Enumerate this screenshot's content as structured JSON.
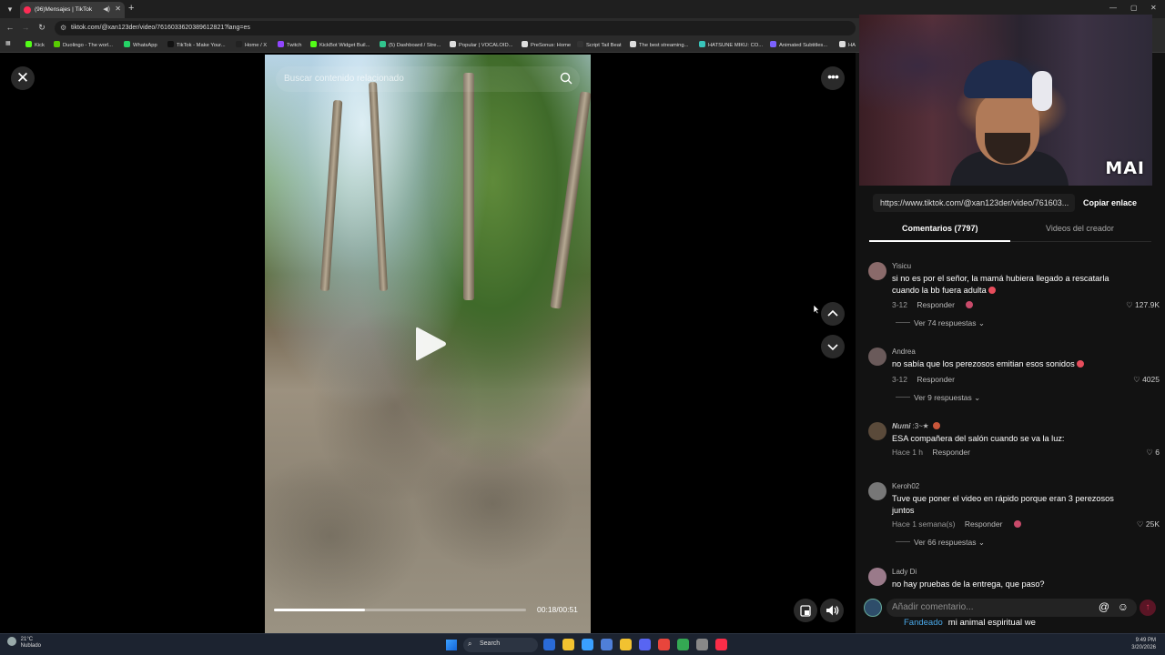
{
  "browser": {
    "tab_title": "(96)Mensajes | TikTok",
    "url": "tiktok.com/@xan123der/video/7616033620389612821?lang=es",
    "bookmarks": [
      {
        "label": "Kick",
        "color": "#53fc18"
      },
      {
        "label": "Duolingo - The worl...",
        "color": "#58cc02"
      },
      {
        "label": "WhatsApp",
        "color": "#25d366"
      },
      {
        "label": "TikTok - Make Your...",
        "color": "#111111"
      },
      {
        "label": "Home / X",
        "color": "#222222"
      },
      {
        "label": "Twitch",
        "color": "#9146ff"
      },
      {
        "label": "KickBot Widget Buil...",
        "color": "#53fc18"
      },
      {
        "label": "(5) Dashboard / Stre...",
        "color": "#31c48d"
      },
      {
        "label": "Popular | VOCALOID...",
        "color": "#dddddd"
      },
      {
        "label": "PreSonus: Home",
        "color": "#dddddd"
      },
      {
        "label": "Script Tail Beat",
        "color": "#333333"
      },
      {
        "label": "The best streaming...",
        "color": "#dddddd"
      },
      {
        "label": "HATSUNE MIKU: CO...",
        "color": "#39c5bb"
      },
      {
        "label": "Animated Subtitles...",
        "color": "#7b61ff"
      },
      {
        "label": "HA",
        "color": "#dddddd"
      }
    ]
  },
  "video": {
    "search_placeholder": "Buscar contenido relacionado",
    "time": "00:18/00:51",
    "progress_fraction": 0.36
  },
  "overlay": {
    "streamer_tag": "MAI"
  },
  "share": {
    "url": "https://www.tiktok.com/@xan123der/video/761603...",
    "copy_label": "Copiar enlace"
  },
  "panel_tabs": [
    {
      "label": "Comentarios (7797)"
    },
    {
      "label": "Videos del creador"
    }
  ],
  "comments": [
    {
      "user": "Yisicu",
      "text": "si no es por el señor, la mamá hubiera llegado a rescatarla cuando la bb fuera adulta",
      "date": "3-12",
      "reply": "Responder",
      "likes": "127.9K",
      "more": "Ver 74 respuestas",
      "avatar_color": "#8a6a6a"
    },
    {
      "user": "Andrea",
      "text": "no sabía que los perezosos emitian esos sonidos",
      "date": "3-12",
      "reply": "Responder",
      "likes": "4025",
      "more": "Ver 9 respuestas",
      "avatar_color": "#6a5a5a"
    },
    {
      "user": "𝑵𝒖𝒎𝒊 :3~★",
      "text": "ESA compañera del salón cuando se va la luz:",
      "date": "Hace 1 h",
      "reply": "Responder",
      "likes": "6",
      "more": "",
      "avatar_color": "#5a4a3a"
    },
    {
      "user": "Keroh02",
      "text": "Tuve que poner el video en rápido porque eran 3 perezosos juntos",
      "date": "Hace 1 semana(s)",
      "reply": "Responder",
      "likes": "25K",
      "more": "Ver 66 respuestas",
      "avatar_color": "#777777"
    },
    {
      "user": "Lady Di",
      "text": "no hay pruebas de la entrega, que paso?",
      "date": "",
      "reply": "",
      "likes": "",
      "more": "",
      "avatar_color": "#9a7a8a"
    }
  ],
  "comment_input": {
    "placeholder": "Añadir comentario..."
  },
  "ticker": {
    "user": "Fandeado",
    "text": "mi animal espiritual we"
  },
  "taskbar": {
    "temp": "21°C",
    "condition": "Nublado",
    "search_label": "Search",
    "time": "9:49 PM",
    "date": "3/20/2026",
    "apps": [
      "#2a6bd8",
      "#f2c230",
      "#3aa0ff",
      "#4f7fd8",
      "#f2c230",
      "#5865f2",
      "#e8453c",
      "#34a853",
      "#888888",
      "#fa2d48"
    ]
  }
}
